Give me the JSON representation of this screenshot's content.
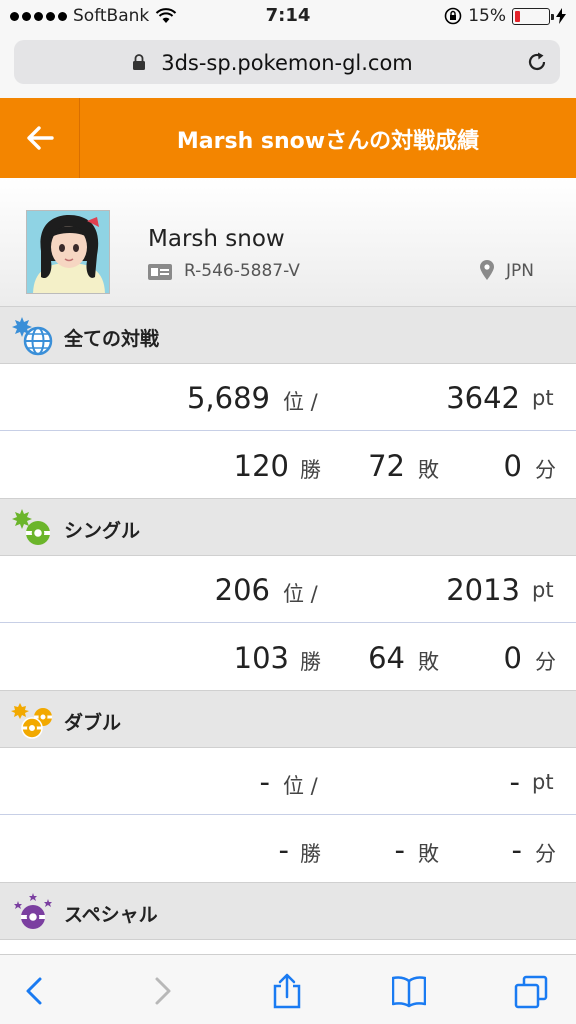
{
  "status_bar": {
    "carrier": "SoftBank",
    "time": "7:14",
    "battery": "15%"
  },
  "browser": {
    "url": "3ds-sp.pokemon-gl.com"
  },
  "header": {
    "title": "Marsh snowさんの対戦成績"
  },
  "profile": {
    "name": "Marsh snow",
    "player_id": "R-546-5887-V",
    "country": "JPN"
  },
  "sections": [
    {
      "title": "全ての対戦",
      "rank": "5,689",
      "rank_unit": "位 /",
      "points": "3642",
      "points_unit": "pt",
      "wins": "120",
      "wins_unit": "勝",
      "losses": "72",
      "losses_unit": "敗",
      "draws": "0",
      "draws_unit": "分"
    },
    {
      "title": "シングル",
      "rank": "206",
      "rank_unit": "位 /",
      "points": "2013",
      "points_unit": "pt",
      "wins": "103",
      "wins_unit": "勝",
      "losses": "64",
      "losses_unit": "敗",
      "draws": "0",
      "draws_unit": "分"
    },
    {
      "title": "ダブル",
      "rank": "-",
      "rank_unit": "位 /",
      "points": "-",
      "points_unit": "pt",
      "wins": "-",
      "wins_unit": "勝",
      "losses": "-",
      "losses_unit": "敗",
      "draws": "-",
      "draws_unit": "分"
    },
    {
      "title": "スペシャル"
    }
  ],
  "colors": {
    "header": "#f38500",
    "all_battles_icon": "#3a8fd8",
    "single_icon": "#6bb52b",
    "double_icon": "#f2a900",
    "special_icon": "#7b3fa0",
    "toolbar_icon": "#1a7bf2"
  },
  "icons": {
    "back": "arrow-left-icon",
    "all_battles": "globe-icon",
    "single": "pokeball-single-icon",
    "double": "pokeball-double-icon",
    "special": "pokeball-special-icon",
    "toolbar": [
      "back-chevron-icon",
      "forward-chevron-icon",
      "share-icon",
      "bookmarks-icon",
      "tabs-icon"
    ]
  }
}
